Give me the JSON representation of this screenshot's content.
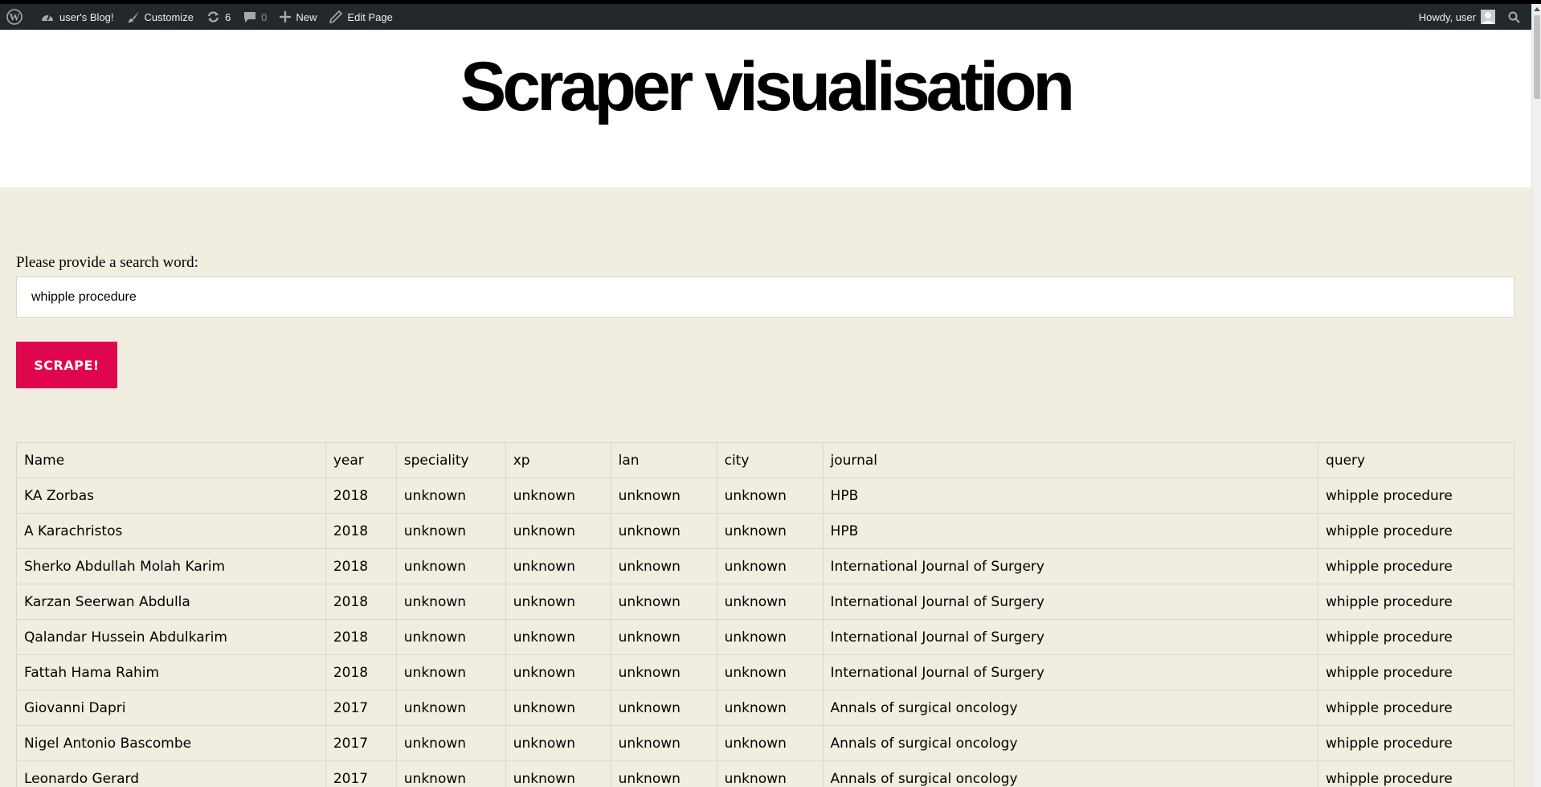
{
  "admin_bar": {
    "site_name": "user's Blog!",
    "customize": "Customize",
    "updates_count": "6",
    "comments_count": "0",
    "new": "New",
    "edit_page": "Edit Page",
    "howdy": "Howdy, user",
    "icons": [
      "wordpress-icon",
      "dashboard-icon",
      "brush-icon",
      "refresh-icon",
      "comment-icon",
      "plus-icon",
      "pencil-icon",
      "avatar-icon",
      "search-icon"
    ],
    "background": "#23282d"
  },
  "header": {
    "title": "Scraper visualisation"
  },
  "search": {
    "label": "Please provide a search word:",
    "value": "whipple procedure",
    "button_label": "SCRAPE!",
    "button_color": "#e0064e"
  },
  "table": {
    "columns": [
      "Name",
      "year",
      "speciality",
      "xp",
      "lan",
      "city",
      "journal",
      "query"
    ],
    "rows": [
      [
        "KA Zorbas",
        "2018",
        "unknown",
        "unknown",
        "unknown",
        "unknown",
        "HPB",
        "whipple procedure"
      ],
      [
        "A Karachristos",
        "2018",
        "unknown",
        "unknown",
        "unknown",
        "unknown",
        "HPB",
        "whipple procedure"
      ],
      [
        "Sherko Abdullah Molah Karim",
        "2018",
        "unknown",
        "unknown",
        "unknown",
        "unknown",
        "International Journal of Surgery",
        "whipple procedure"
      ],
      [
        "Karzan Seerwan Abdulla",
        "2018",
        "unknown",
        "unknown",
        "unknown",
        "unknown",
        "International Journal of Surgery",
        "whipple procedure"
      ],
      [
        "Qalandar Hussein Abdulkarim",
        "2018",
        "unknown",
        "unknown",
        "unknown",
        "unknown",
        "International Journal of Surgery",
        "whipple procedure"
      ],
      [
        "Fattah Hama Rahim",
        "2018",
        "unknown",
        "unknown",
        "unknown",
        "unknown",
        "International Journal of Surgery",
        "whipple procedure"
      ],
      [
        "Giovanni Dapri",
        "2017",
        "unknown",
        "unknown",
        "unknown",
        "unknown",
        "Annals of surgical oncology",
        "whipple procedure"
      ],
      [
        "Nigel Antonio Bascombe",
        "2017",
        "unknown",
        "unknown",
        "unknown",
        "unknown",
        "Annals of surgical oncology",
        "whipple procedure"
      ],
      [
        "Leonardo Gerard",
        "2017",
        "unknown",
        "unknown",
        "unknown",
        "unknown",
        "Annals of surgical oncology",
        "whipple procedure"
      ]
    ]
  },
  "colors": {
    "content_background": "#f1ede0",
    "header_background": "#ffffff",
    "border": "#dcd7ca"
  }
}
